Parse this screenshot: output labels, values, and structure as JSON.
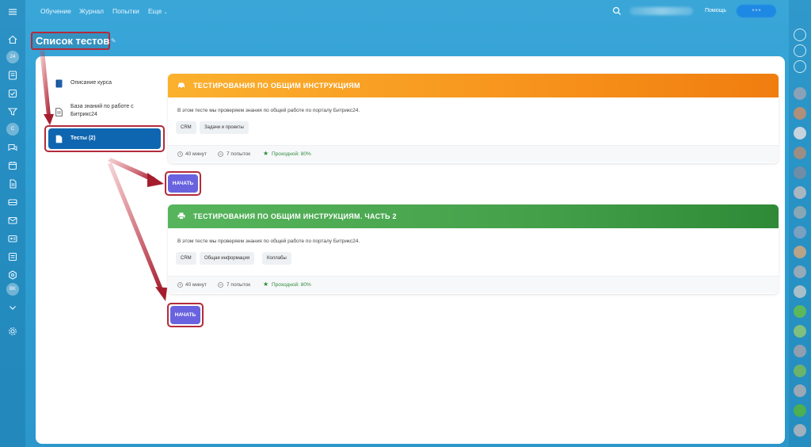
{
  "topbar": {
    "links": [
      "Обучение",
      "Журнал",
      "Попытки",
      "Еще"
    ],
    "help_label": "Помощь",
    "button_label": "• • •"
  },
  "page": {
    "title": "Список тестов"
  },
  "sidebar": {
    "items": [
      {
        "label": "Описание курса",
        "icon": "book-icon"
      },
      {
        "label": "База знаний по работе с Битрикс24",
        "icon": "document-icon"
      },
      {
        "label": "Тесты (2)",
        "icon": "test-icon",
        "active": true
      }
    ]
  },
  "tests": [
    {
      "title": "ТЕСТИРОВАНИЯ ПО ОБЩИМ ИНСТРУКЦИЯМ",
      "description": "В этом тесте мы проверяем знания по общей работе по порталу Битрикс24.",
      "tags": [
        "CRM",
        "Задачи и проекты"
      ],
      "duration": "40 минут",
      "attempts": "7 попыток",
      "pass": "Проходной: 80%",
      "start_label": "НАЧАТЬ",
      "color": "#f7931c"
    },
    {
      "title": "ТЕСТИРОВАНИЯ ПО ОБЩИМ ИНСТРУКЦИЯМ. ЧАСТЬ 2",
      "description": "В этом тесте мы проверяем знания по общей работе по порталу Битрикс24.",
      "tags": [
        "CRM",
        "Общая информация",
        "Коллабы"
      ],
      "duration": "40 минут",
      "attempts": "7 попыток",
      "pass": "Проходной: 80%",
      "start_label": "НАЧАТЬ",
      "color": "#45a04a"
    }
  ],
  "colors": {
    "accent": "#6a63e0",
    "highlight": "#b32b3b",
    "nav_active": "#0f66b0"
  }
}
